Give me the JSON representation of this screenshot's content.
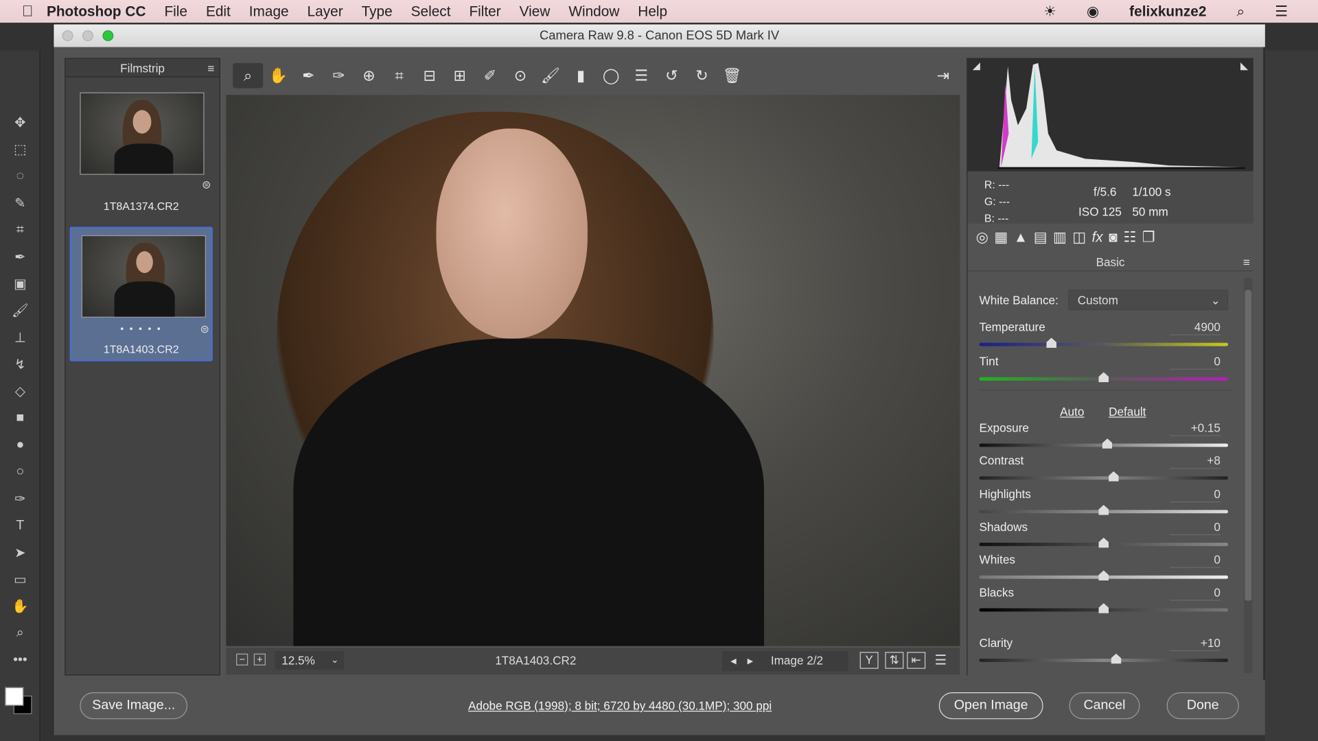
{
  "menubar": {
    "app": "Photoshop CC",
    "items": [
      "File",
      "Edit",
      "Image",
      "Layer",
      "Type",
      "Select",
      "Filter",
      "View",
      "Window",
      "Help"
    ],
    "user": "felixkunze2"
  },
  "dialog": {
    "title": "Camera Raw 9.8  -  Canon EOS 5D Mark IV"
  },
  "filmstrip": {
    "title": "Filmstrip",
    "items": [
      {
        "name": "1T8A1374.CR2",
        "selected": false
      },
      {
        "name": "1T8A1403.CR2",
        "selected": true,
        "rating_dots": "• • • • •"
      }
    ]
  },
  "toolbar": {
    "tools": [
      "zoom-icon",
      "hand-icon",
      "white-balance-icon",
      "color-sampler-icon",
      "targeted-adjustment-icon",
      "crop-icon",
      "straighten-icon",
      "transform-icon",
      "spot-removal-icon",
      "red-eye-icon",
      "adjustment-brush-icon",
      "graduated-filter-icon",
      "radial-filter-icon",
      "preferences-icon",
      "rotate-left-icon",
      "rotate-right-icon",
      "trash-icon"
    ]
  },
  "bottombar": {
    "zoom": "12.5%",
    "filename": "1T8A1403.CR2",
    "image_counter": "Image 2/2"
  },
  "info": {
    "r_label": "R:",
    "g_label": "G:",
    "b_label": "B:",
    "r": "---",
    "g": "---",
    "b": "---",
    "aperture": "f/5.6",
    "shutter": "1/100 s",
    "iso": "ISO 125",
    "focal": "50 mm"
  },
  "panel": {
    "title": "Basic",
    "white_balance_label": "White Balance:",
    "white_balance": "Custom",
    "auto": "Auto",
    "default": "Default",
    "sliders": [
      {
        "label": "Temperature",
        "value": "4900",
        "position": 0.29,
        "track": "linear-gradient(90deg,#1a1f8a,#5a5a5a 50%,#c8c81e)"
      },
      {
        "label": "Tint",
        "value": "0",
        "position": 0.5,
        "track": "linear-gradient(90deg,#22b422,#5a5a5a 50%,#b41eb4)"
      },
      {
        "label": "Exposure",
        "value": "+0.15",
        "position": 0.515,
        "track": "linear-gradient(90deg,#111,#eee)"
      },
      {
        "label": "Contrast",
        "value": "+8",
        "position": 0.54,
        "track": "linear-gradient(90deg,#222,#888 50%,#222)"
      },
      {
        "label": "Highlights",
        "value": "0",
        "position": 0.5,
        "track": "linear-gradient(90deg,#444,#ddd)"
      },
      {
        "label": "Shadows",
        "value": "0",
        "position": 0.5,
        "track": "linear-gradient(90deg,#111,#888)"
      },
      {
        "label": "Whites",
        "value": "0",
        "position": 0.5,
        "track": "linear-gradient(90deg,#777,#eee)"
      },
      {
        "label": "Blacks",
        "value": "0",
        "position": 0.5,
        "track": "linear-gradient(90deg,#000,#777)"
      },
      {
        "label": "Clarity",
        "value": "+10",
        "position": 0.55,
        "track": "linear-gradient(90deg,#222,#888 50%,#222)"
      }
    ]
  },
  "footer": {
    "save": "Save Image...",
    "workflow": "Adobe RGB (1998); 8 bit; 6720 by 4480 (30.1MP); 300 ppi",
    "open": "Open Image",
    "cancel": "Cancel",
    "done": "Done"
  }
}
